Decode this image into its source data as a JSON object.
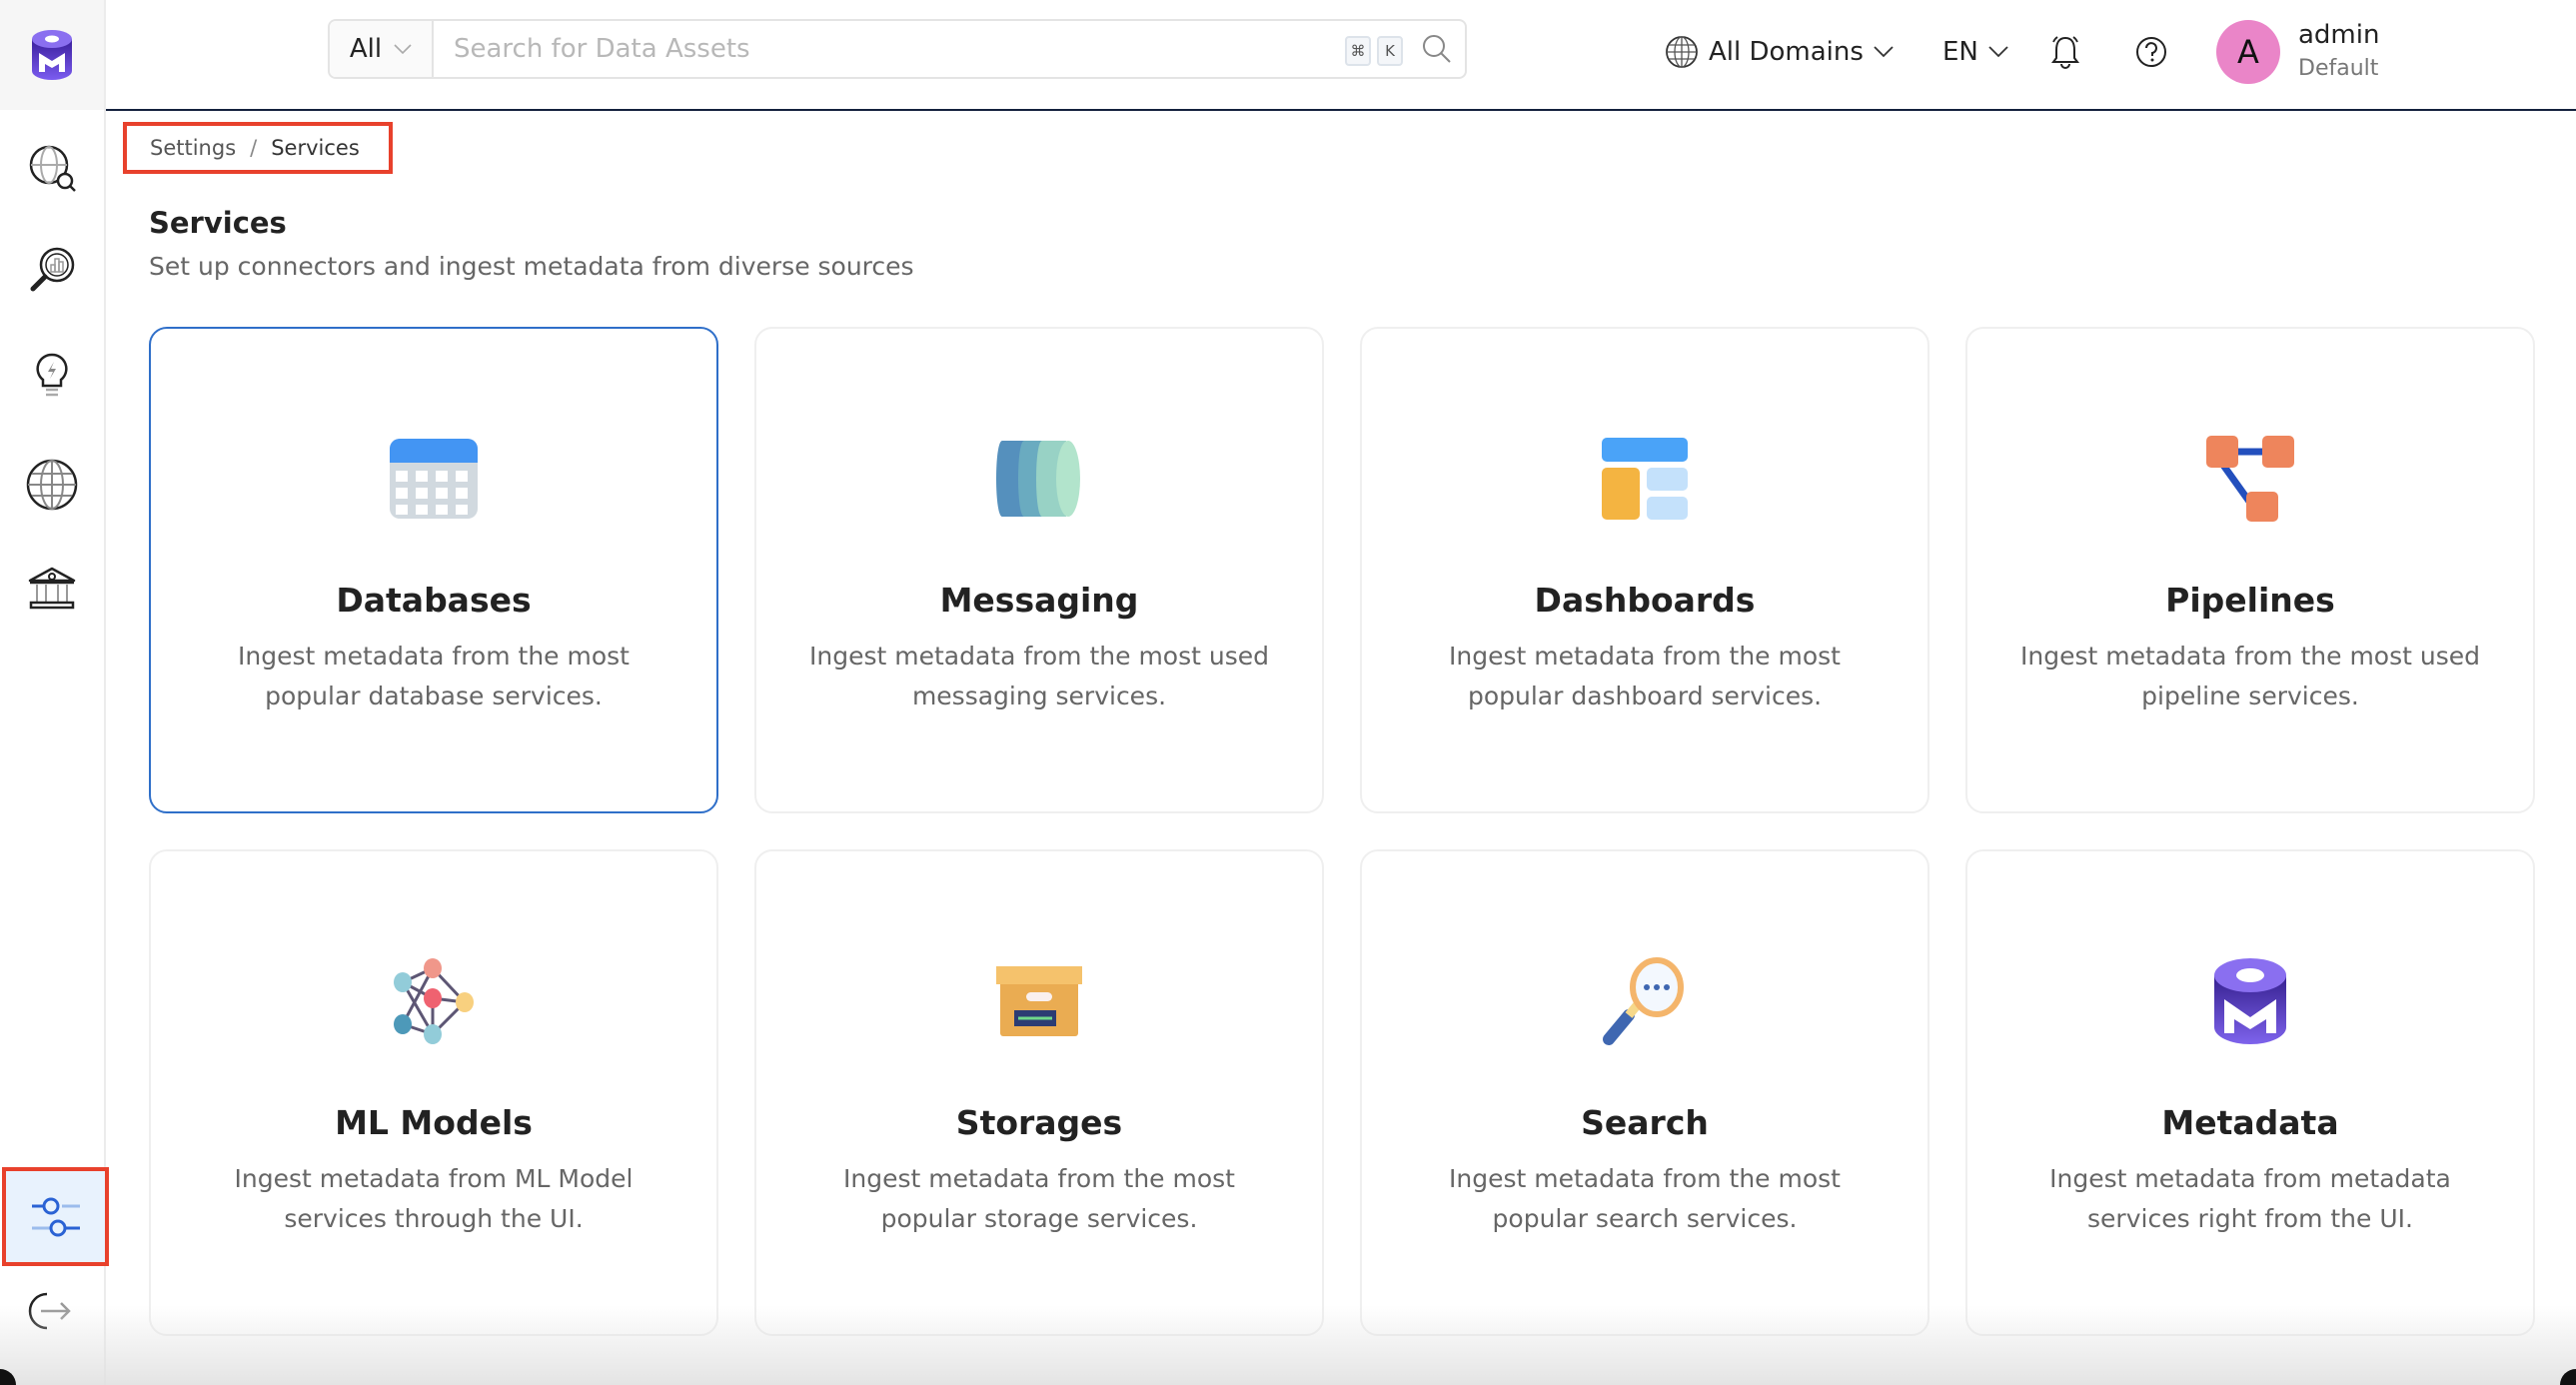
{
  "sidebar": {
    "logo": "openmetadata-logo",
    "items": [
      {
        "name": "explore",
        "icon": "globe-search-icon"
      },
      {
        "name": "data-insights",
        "icon": "magnifier-chart-icon"
      },
      {
        "name": "observability",
        "icon": "lightbulb-bolt-icon"
      },
      {
        "name": "domains",
        "icon": "globe-icon"
      },
      {
        "name": "governance",
        "icon": "bank-icon"
      }
    ],
    "settings": {
      "icon": "sliders-icon",
      "active": true
    },
    "logout": {
      "icon": "logout-icon"
    }
  },
  "header": {
    "search": {
      "filter_label": "All",
      "placeholder": "Search for Data Assets",
      "value": "",
      "shortcut_keys": [
        "⌘",
        "K"
      ]
    },
    "domain_label": "All Domains",
    "language_label": "EN",
    "user": {
      "initial": "A",
      "name": "admin",
      "role": "Default",
      "avatar_color": "#ea85c8"
    }
  },
  "breadcrumb": [
    {
      "label": "Settings"
    },
    {
      "label": "Services"
    }
  ],
  "breadcrumb_separator": "/",
  "page": {
    "title": "Services",
    "subtitle": "Set up connectors and ingest metadata from diverse sources"
  },
  "cards": [
    {
      "title": "Databases",
      "description": "Ingest metadata from the most popular database services.",
      "icon": "database-icon"
    },
    {
      "title": "Messaging",
      "description": "Ingest metadata from the most used messaging services.",
      "icon": "messaging-icon"
    },
    {
      "title": "Dashboards",
      "description": "Ingest metadata from the most popular dashboard services.",
      "icon": "dashboard-icon"
    },
    {
      "title": "Pipelines",
      "description": "Ingest metadata from the most used pipeline services.",
      "icon": "pipeline-icon"
    },
    {
      "title": "ML Models",
      "description": "Ingest metadata from ML Model services through the UI.",
      "icon": "ml-model-icon"
    },
    {
      "title": "Storages",
      "description": "Ingest metadata from the most popular storage services.",
      "icon": "storage-icon"
    },
    {
      "title": "Search",
      "description": "Ingest metadata from the most popular search services.",
      "icon": "search-service-icon"
    },
    {
      "title": "Metadata",
      "description": "Ingest metadata from metadata services right from the UI.",
      "icon": "metadata-icon"
    }
  ],
  "colors": {
    "accent": "#2f6fc9",
    "highlight_outline": "#e8412c",
    "brand_purple": "#7147e8",
    "header_border": "#14213d"
  }
}
